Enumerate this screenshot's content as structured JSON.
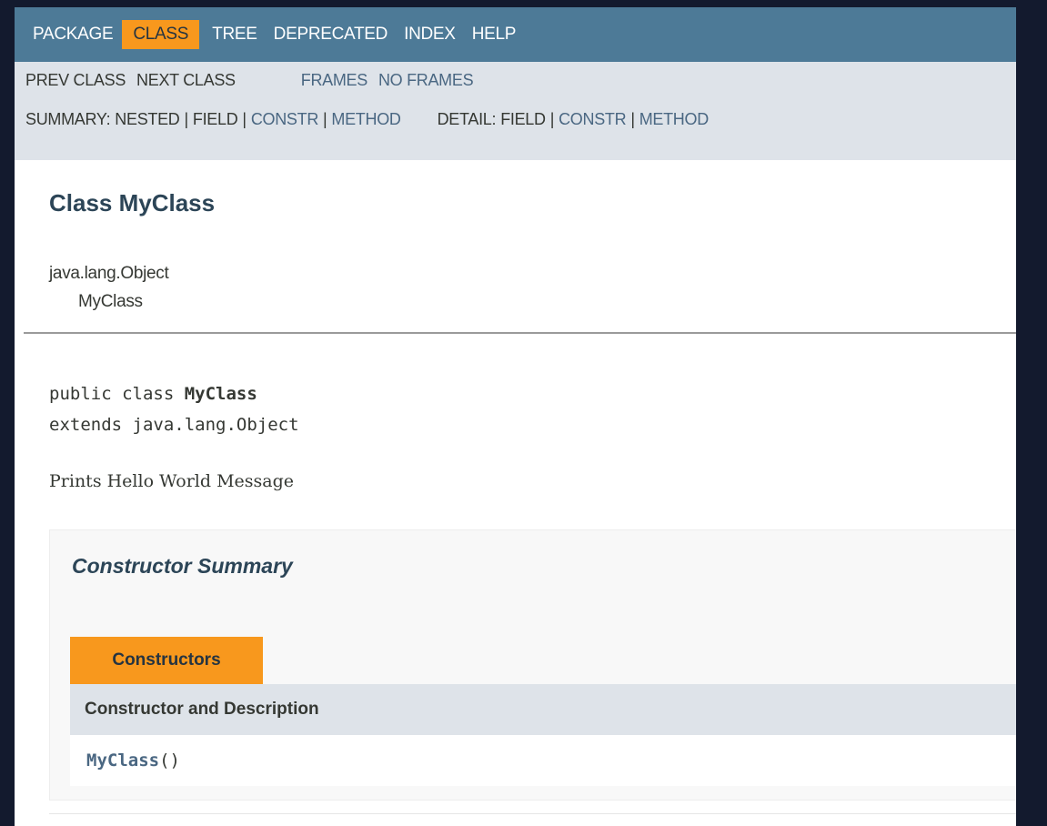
{
  "topnav": {
    "items": [
      {
        "label": "PACKAGE",
        "active": false
      },
      {
        "label": "CLASS",
        "active": true
      },
      {
        "label": "TREE",
        "active": false
      },
      {
        "label": "DEPRECATED",
        "active": false
      },
      {
        "label": "INDEX",
        "active": false
      },
      {
        "label": "HELP",
        "active": false
      }
    ]
  },
  "subnav": {
    "prev_class": "PREV CLASS",
    "next_class": "NEXT CLASS",
    "frames": "FRAMES",
    "no_frames": "NO FRAMES",
    "summary_label": "SUMMARY:",
    "summary_nested": "NESTED",
    "summary_field": "FIELD",
    "summary_constr": "CONSTR",
    "summary_method": "METHOD",
    "detail_label": "DETAIL:",
    "detail_field": "FIELD",
    "detail_constr": "CONSTR",
    "detail_method": "METHOD",
    "separator": "|"
  },
  "content": {
    "class_title": "Class MyClass",
    "inheritance_root": "java.lang.Object",
    "inheritance_child": "MyClass",
    "signature_prefix": "public class ",
    "signature_name": "MyClass",
    "signature_extends": "extends java.lang.Object",
    "description": "Prints Hello World Message"
  },
  "constructor_summary": {
    "heading": "Constructor Summary",
    "caption": "Constructors",
    "column_header": "Constructor and Description",
    "rows": [
      {
        "name": "MyClass",
        "params": "()"
      }
    ]
  },
  "colors": {
    "nav_background": "#4d7a97",
    "active_tab": "#f8981d",
    "subnav_background": "#dee3e9",
    "link": "#4a6782",
    "title": "#2c4557"
  }
}
